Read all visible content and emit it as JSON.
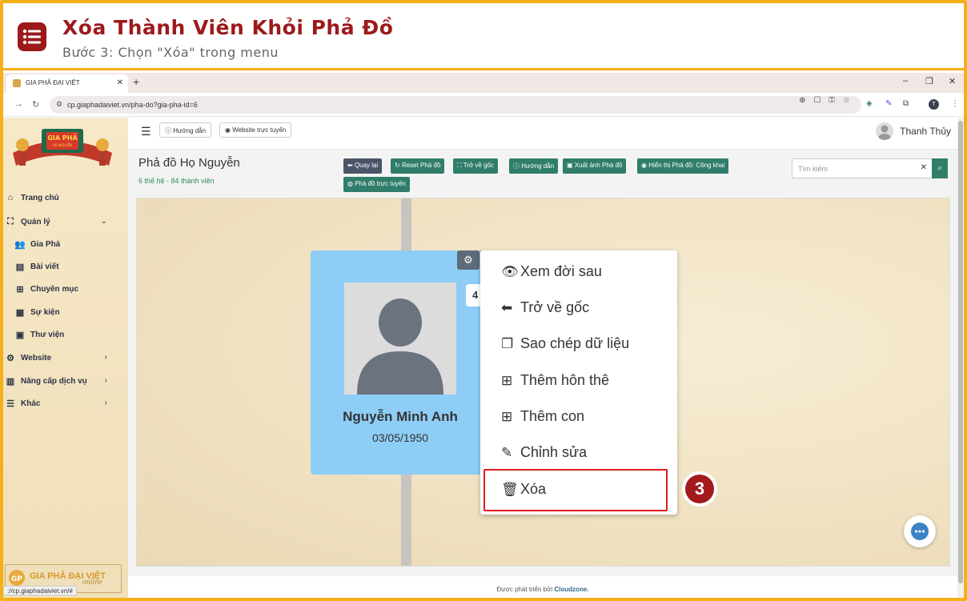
{
  "header": {
    "title": "Xóa Thành Viên Khỏi Phả Đồ",
    "subtitle": "Bước 3: Chọn \"Xóa\" trong menu"
  },
  "browser": {
    "tab_title": "GIA PHẢ ĐẠI VIỆT",
    "url": "cp.giaphadaiviet.vn/pha-do?gia-pha-id=6",
    "profile_initial": "T",
    "status_url": "://cp.giaphadaiviet.vn/#"
  },
  "sidebar": {
    "items": [
      {
        "label": "Trang chủ",
        "icon": "home-icon"
      },
      {
        "label": "Quản lý",
        "icon": "sitemap-icon"
      },
      {
        "label": "Gia Phả",
        "icon": "users-icon"
      },
      {
        "label": "Bài viết",
        "icon": "newspaper-icon"
      },
      {
        "label": "Chuyên mục",
        "icon": "grid-icon"
      },
      {
        "label": "Sự kiện",
        "icon": "calendar-icon"
      },
      {
        "label": "Thư viện",
        "icon": "images-icon"
      },
      {
        "label": "Website",
        "icon": "gear-icon"
      },
      {
        "label": "Nâng cấp dịch vụ",
        "icon": "chart-icon"
      },
      {
        "label": "Khác",
        "icon": "bars-icon"
      }
    ],
    "logo_text": "GIA PHẢ ĐẠI VIỆT",
    "logo_online": "online"
  },
  "topbar": {
    "guide": "Hướng dẫn",
    "website": "Website trực tuyến",
    "user_name": "Thanh Thủy"
  },
  "page": {
    "title": "Phả đồ Họ Nguyễn",
    "subtitle": "6 thế hệ - 84 thành viên",
    "search_placeholder": "Tìm kiếm"
  },
  "toolbar": {
    "back": "Quay lại",
    "reset": "Reset Phả đồ",
    "root": "Trở về gốc",
    "guide": "Hướng dẫn",
    "export": "Xuất ảnh Phả đồ",
    "visibility": "Hiển thị Phả đồ: Công khai",
    "online": "Phả đồ trực tuyến"
  },
  "member": {
    "name": "Nguyễn Minh Anh",
    "dob": "03/05/1950",
    "badge": "4"
  },
  "context_menu": {
    "items": [
      {
        "label": "Xem đời sau",
        "icon": "eye-icon"
      },
      {
        "label": "Trở về gốc",
        "icon": "arrow-left-icon"
      },
      {
        "label": "Sao chép dữ liệu",
        "icon": "copy-icon"
      },
      {
        "label": "Thêm hôn thê",
        "icon": "plus-square-icon"
      },
      {
        "label": "Thêm con",
        "icon": "plus-square-icon"
      },
      {
        "label": "Chỉnh sửa",
        "icon": "edit-icon"
      },
      {
        "label": "Xóa",
        "icon": "trash-icon"
      }
    ]
  },
  "step_number": "3",
  "footer": {
    "prefix": "Được phát triển bởi",
    "brand": "Cloudzone."
  },
  "colors": {
    "brand": "#9c1a1c",
    "accent": "#f5b018",
    "button": "#2f7d6a"
  }
}
